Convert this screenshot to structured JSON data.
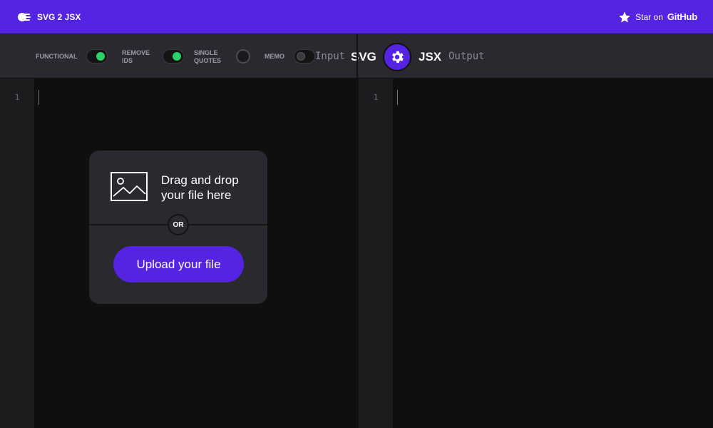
{
  "header": {
    "brand": "SVG 2 JSX",
    "star_prefix": "Star on",
    "star_brand": "GitHub"
  },
  "options": [
    {
      "label_line1": "FUNCTIONAL",
      "label_line2": "",
      "state": "on"
    },
    {
      "label_line1": "REMOVE",
      "label_line2": "IDS",
      "state": "on"
    },
    {
      "label_line1": "SINGLE",
      "label_line2": "QUOTES",
      "state": "off"
    },
    {
      "label_line1": "MEMO",
      "label_line2": "",
      "state": "off"
    }
  ],
  "io": {
    "input_label": "Input",
    "svg_label": "SVG",
    "jsx_label": "JSX",
    "output_label": "Output"
  },
  "editors": {
    "input_line": "1",
    "output_line": "1"
  },
  "dropzone": {
    "text": "Drag and drop your file here",
    "or": "OR",
    "upload_label": "Upload your file"
  },
  "colors": {
    "accent": "#5523e2",
    "toggle_on": "#2ad16a",
    "panel": "#2a2930",
    "editor_bg": "#0f0f0f"
  }
}
